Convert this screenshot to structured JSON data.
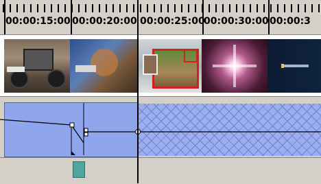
{
  "ruler": {
    "timecodes": [
      "00:00:15:00",
      "00:00:20:00",
      "00:00:25:00",
      "00:00:30:00",
      "00:00:3"
    ]
  },
  "video_track": {
    "thumbnails": [
      "monster-truck",
      "monster-truck-blend",
      "picture-in-picture",
      "light-flare",
      "title-card"
    ]
  },
  "audio_track": {
    "clip_color": "#8fa6ec",
    "hatch_color": "#9aaef0"
  },
  "colors": {
    "ruler_bg": "#d4d0c8",
    "marker": "#4fa6a0",
    "pip_border": "#d21f1f"
  }
}
